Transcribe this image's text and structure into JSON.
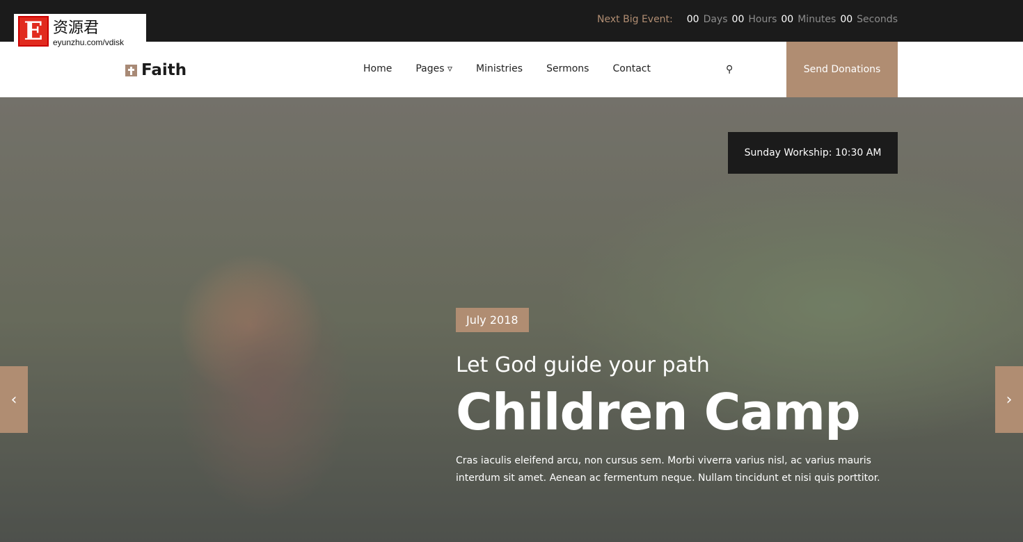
{
  "watermark": {
    "letter": "E",
    "chinese": "资源君",
    "url": "eyunzhu.com/vdisk"
  },
  "countdown": {
    "label": "Next Big Event:",
    "days": "00",
    "days_label": "Days",
    "hours": "00",
    "hours_label": "Hours",
    "minutes": "00",
    "minutes_label": "Minutes",
    "seconds": "00",
    "seconds_label": "Seconds"
  },
  "brand": "Faith",
  "nav": {
    "items": [
      {
        "label": "Home"
      },
      {
        "label": "Pages ▿"
      },
      {
        "label": "Ministries"
      },
      {
        "label": "Sermons"
      },
      {
        "label": "Contact"
      }
    ],
    "search_icon": "⚲",
    "donate": "Send Donations"
  },
  "hero": {
    "worship": "Sunday Workship: 10:30 AM",
    "date": "July 2018",
    "subtitle": "Let God guide your path",
    "title": "Children Camp",
    "description": "Cras iaculis eleifend arcu, non cursus sem. Morbi viverra varius nisl, ac varius mauris interdum sit amet. Aenean ac fermentum neque. Nullam tincidunt et nisi quis porttitor.",
    "prev": "‹",
    "next": "›"
  },
  "colors": {
    "accent": "#b08d72",
    "dark": "#1b1b1b"
  }
}
